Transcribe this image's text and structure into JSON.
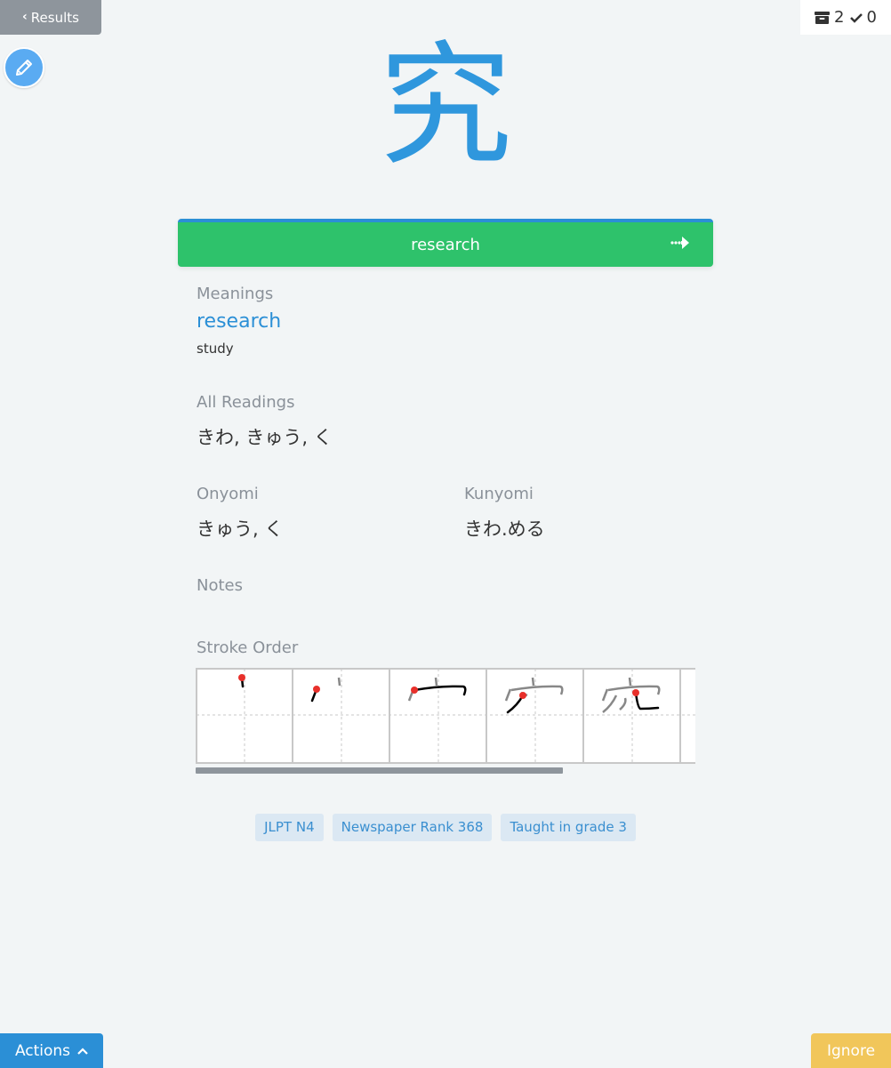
{
  "nav": {
    "results_label": "Results",
    "counter_review_count": "2",
    "counter_done_count": "0"
  },
  "card": {
    "kanji": "究",
    "answer": "research"
  },
  "meanings": {
    "heading": "Meanings",
    "primary": "research",
    "secondary": "study"
  },
  "readings": {
    "heading": "All Readings",
    "value": "きわ, きゅう, く"
  },
  "onyomi": {
    "heading": "Onyomi",
    "value": "きゅう, く"
  },
  "kunyomi": {
    "heading": "Kunyomi",
    "value": "きわ.める"
  },
  "notes": {
    "heading": "Notes"
  },
  "stroke_order": {
    "heading": "Stroke Order"
  },
  "tags": [
    "JLPT N4",
    "Newspaper Rank 368",
    "Taught in grade 3"
  ],
  "footer": {
    "actions_label": "Actions",
    "ignore_label": "Ignore"
  },
  "colors": {
    "accent": "#2f97dd",
    "answer_bar": "#2ec26b",
    "ignore": "#f1c65a"
  },
  "icons": [
    "chevron-left-icon",
    "pencil-icon",
    "archive-icon",
    "check-icon",
    "arrow-right-icon",
    "chevron-up-icon"
  ]
}
